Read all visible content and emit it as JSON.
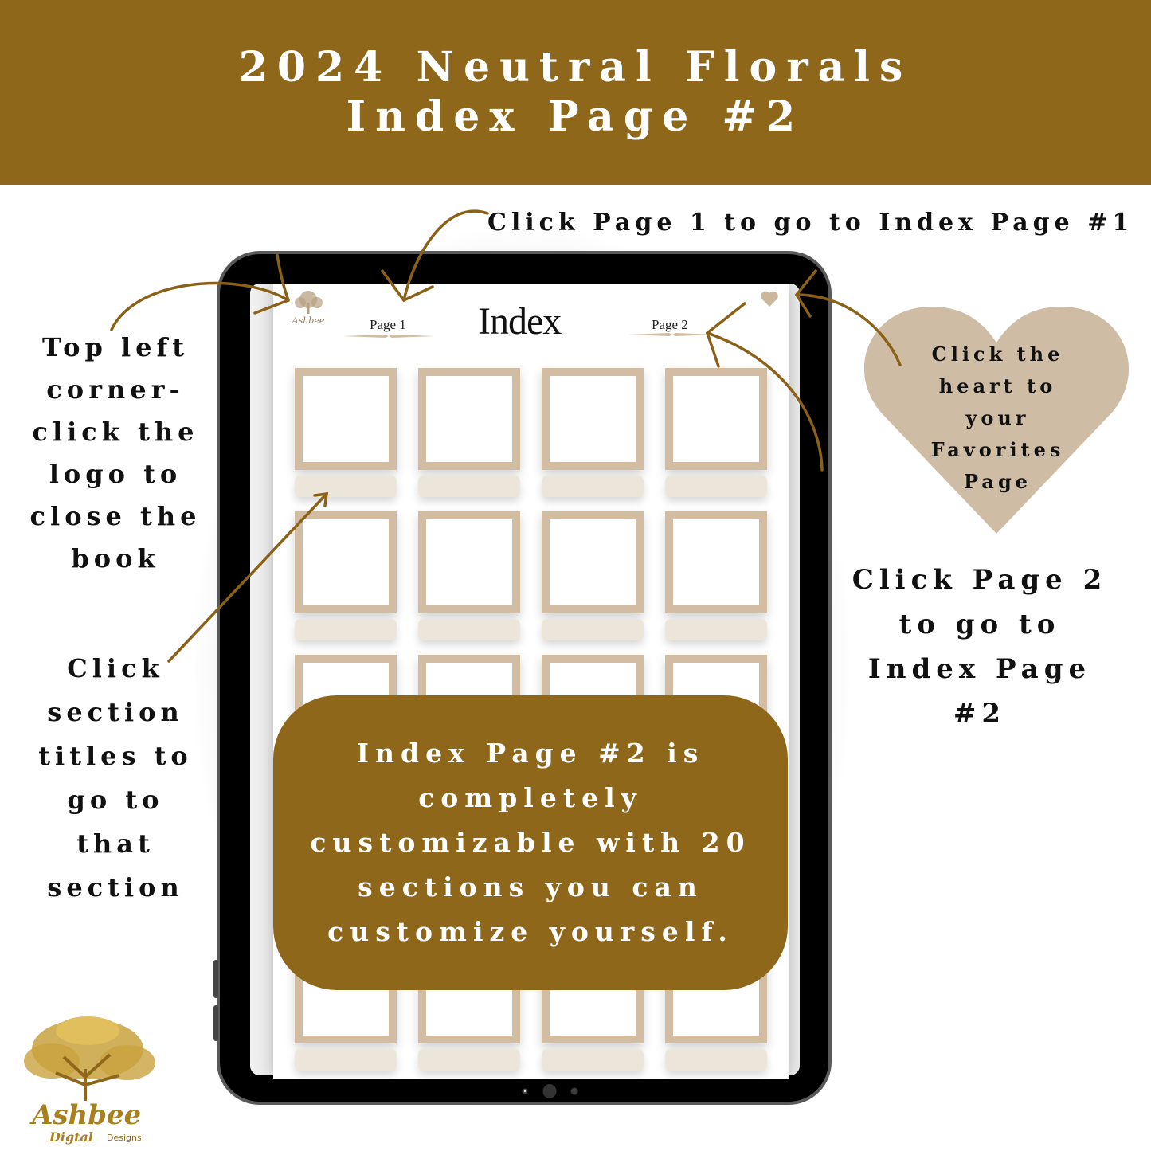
{
  "banner": {
    "line1": "2024 Neutral Florals",
    "line2": "Index Page #2",
    "color": "#8f671a"
  },
  "callouts": {
    "page1": "Click Page 1 to go to Index Page #1",
    "logo": "Top left\ncorner-\nclick the\nlogo to\nclose the\nbook",
    "sections": "Click\nsection\ntitles to\ngo to\nthat\nsection",
    "page2": "Click Page 2\nto go to\nIndex Page\n#2",
    "heart": "Click the\nheart to\nyour\nFavorites\nPage"
  },
  "screen": {
    "title": "Index",
    "nav": {
      "page1": "Page 1",
      "page2": "Page 2"
    },
    "logo_icon": "ashbee-tree-logo",
    "favorites_icon": "heart-icon",
    "grid": {
      "columns": 4,
      "rows": 5,
      "section_count": 20
    }
  },
  "info_box": {
    "text": "Index Page #2 is\ncompletely\ncustomizable with 20\nsections you can\ncustomize yourself."
  },
  "brand": {
    "name": "Ashbee",
    "tagline": "Digtal",
    "suffix": "Designs"
  },
  "colors": {
    "accent_brown": "#8f671a",
    "tan": "#d2bca2",
    "label_beige": "#ece5da"
  }
}
